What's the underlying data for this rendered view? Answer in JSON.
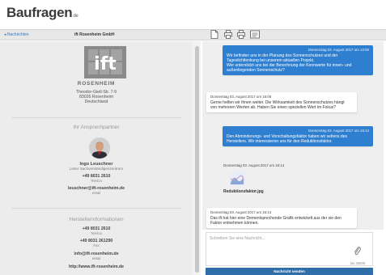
{
  "app": {
    "logo": "Baufragen",
    "logo_suffix": "de"
  },
  "topbar": {
    "back_label": "◂ Nachrichten",
    "company": "ift Rosenheim GmbH"
  },
  "profile": {
    "logo_text": "ift",
    "logo_subtext": "ROSENHEIM",
    "address": [
      "Theodor-Gietl-Str. 7-9",
      "83026 Rosenheim",
      "Deutschland"
    ]
  },
  "contact": {
    "section_title": "Ihr Ansprechpartner",
    "name": "Ingo Leuschner",
    "role": "Leiter Sachverständigenzentrum",
    "phone": "+49 8031 2610",
    "phone_label": "Telefon",
    "email": "leuschner@ift-rosenheim.de",
    "email_label": "eMail"
  },
  "manufacturer": {
    "section_title": "Herstellerinformationen",
    "phone": "+49 8031 2610",
    "phone_label": "Telefon",
    "fax": "+49 8031 261290",
    "fax_label": "Fax",
    "email": "info@ift-rosenheim.de",
    "email_label": "eMail",
    "web": "http://www.ift-rosenheim.de"
  },
  "messages": [
    {
      "time": "Donnerstag 03. August 2017 um 13:59",
      "lines": [
        "Wir befinden uns in der Planung des Sonnenschutzes und der",
        "Tageslichtlenkung bei unserem aktuellen Projekt.",
        "Wer unterstützt uns bei der Berechnung der Kennwerte für innen- und",
        "außenliegenden Sonnenschutz?"
      ]
    },
    {
      "time": "Donnerstag 03. August 2017 um 16:06",
      "lines": [
        "Gerne helfen wir Ihnen weiter. Die Wirksamkeit des Sonnenschutzes hängt",
        "von mehreren Werten ab. Haben Sie einen speziellen Wert im Fokus?"
      ]
    },
    {
      "time": "Donnerstag 03. August 2017 um 16:13",
      "lines": [
        "Den Abminderungs- und Vorschaltungsfaktor haben wir seltens des",
        "Herstellers. Wir interessieren uns für den Reduktionsfaktor."
      ]
    },
    {
      "time": "Donnerstag 03. August 2017 um 16:14",
      "attachment": "Reduktionsfaktor.jpg"
    },
    {
      "time": "Donnerstag 03. August 2017 um 16:14",
      "lines": [
        "Das ift hat hier eine Dementsprechende Grafik entwickelt aus der sie den",
        "Faktor entnehmen können."
      ]
    }
  ],
  "composer": {
    "placeholder": "Schreiben Sie eine Nachricht...",
    "counter": "bis 25000",
    "send_label": "Nachricht senden"
  },
  "colors": {
    "accent": "#2f7fd0",
    "send": "#2f6ea8"
  },
  "icons": [
    "document-icon",
    "print-icon",
    "print-icon",
    "list-icon",
    "paperclip-icon"
  ]
}
